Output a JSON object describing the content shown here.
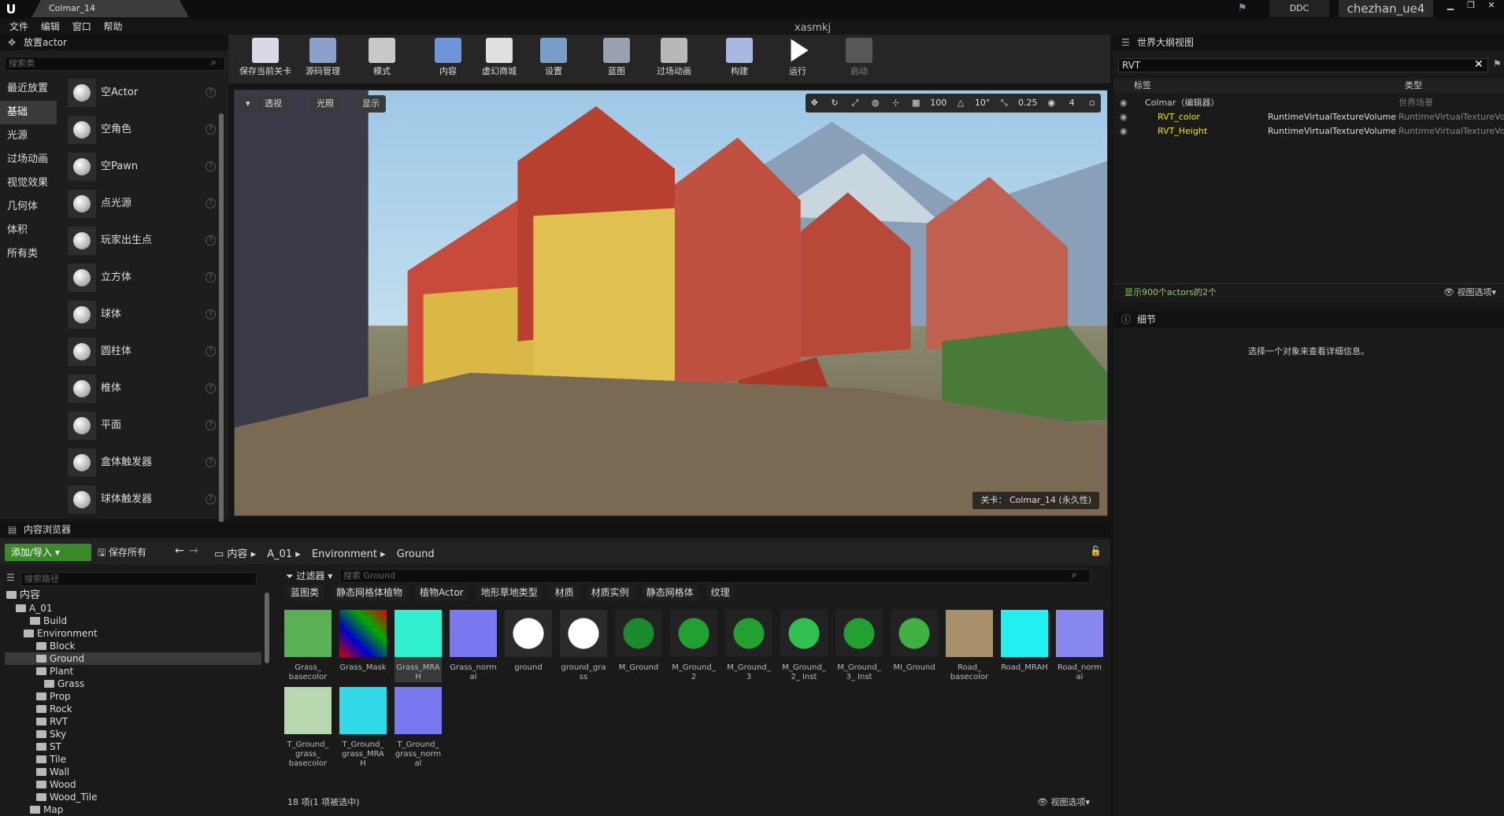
{
  "window": {
    "doc_tab": "Colmar_14",
    "project_name": "xasmkj",
    "ddc": "DDC",
    "project_title": "chezhan_ue4",
    "logo": "U"
  },
  "menu": [
    "文件",
    "编辑",
    "窗口",
    "帮助"
  ],
  "place_panel": {
    "title": "放置actor",
    "search_placeholder": "搜索类",
    "categories": [
      "最近放置",
      "基础",
      "光源",
      "过场动画",
      "视觉效果",
      "几何体",
      "体积",
      "所有类"
    ],
    "items": [
      "空Actor",
      "空角色",
      "空Pawn",
      "点光源",
      "玩家出生点",
      "立方体",
      "球体",
      "圆柱体",
      "椎体",
      "平面",
      "盒体触发器",
      "球体触发器"
    ]
  },
  "toolbar": [
    "保存当前关卡",
    "源码管理",
    "模式",
    "内容",
    "虚幻商城",
    "设置",
    "蓝图",
    "过场动画",
    "构建",
    "运行",
    "启动"
  ],
  "viewport": {
    "perspective": "透视",
    "lit": "光照",
    "show": "显示",
    "grid": "100",
    "angle": "10°",
    "scale": "0.25",
    "cam_speed": "4",
    "level": "关卡：  Colmar_14 (永久性)"
  },
  "outliner": {
    "title": "世界大纲视图",
    "search_value": "RVT",
    "col_label": "标签",
    "col_type": "类型",
    "rows": [
      {
        "label": "Colmar（编辑器）",
        "type": "世界场景"
      },
      {
        "label": "RVT_color",
        "type": "RuntimeVirtualTextureVolume",
        "type2": "RuntimeVirtualTextureVo"
      },
      {
        "label": "RVT_Height",
        "type": "RuntimeVirtualTextureVolume",
        "type2": "RuntimeVirtualTextureVo"
      }
    ],
    "status": "显示900个actors的2个",
    "view_options": "视图选项"
  },
  "details": {
    "title": "细节",
    "message": "选择一个对象来查看详细信息。"
  },
  "content_browser": {
    "title": "内容浏览器",
    "add_import": "添加/导入",
    "save_all": "保存所有",
    "path": [
      "内容",
      "A_01",
      "Environment",
      "Ground"
    ],
    "tree_search": "搜索路径",
    "asset_search": "搜索 Ground",
    "filter_label": "过滤器",
    "tree": [
      "内容",
      "A_01",
      "Build",
      "Environment",
      "Block",
      "Ground",
      "Plant",
      "Grass",
      "Prop",
      "Rock",
      "RVT",
      "Sky",
      "ST",
      "Tile",
      "Wall",
      "Wood",
      "Wood_Tile",
      "Map"
    ],
    "filters": [
      "蓝图类",
      "静态网格体植物",
      "植物Actor",
      "地形草地类型",
      "材质",
      "材质实例",
      "静态网格体",
      "纹理"
    ],
    "assets": [
      "Grass_ basecolor",
      "Grass_Mask",
      "Grass_MRAH",
      "Grass_normal",
      "ground",
      "ground_grass",
      "M_Ground",
      "M_Ground_2",
      "M_Ground_3",
      "M_Ground_2_ Inst",
      "M_Ground_3_ Inst",
      "MI_Ground",
      "Road_ basecolor",
      "Road_MRAH",
      "Road_normal",
      "T_Ground_ grass_ basecolor",
      "T_Ground_ grass_MRAH",
      "T_Ground_ grass_normal"
    ],
    "status": "18 项(1 项被选中)",
    "view_options": "视图选项"
  },
  "colors": {
    "accent_green": "#3a8a2a",
    "selected_text": "#e8e800"
  }
}
